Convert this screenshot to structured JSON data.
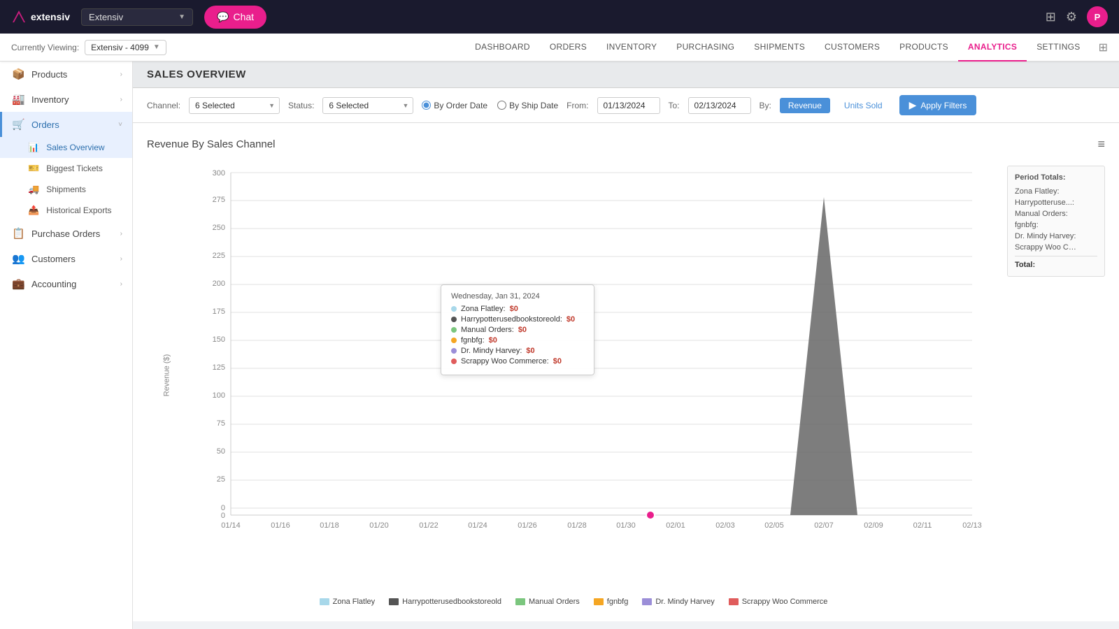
{
  "app": {
    "logo": "extensiv",
    "tenant": "Extensiv",
    "tenant_dropdown_label": "Extensiv",
    "chat_button": "Chat",
    "avatar_initials": "P"
  },
  "subheader": {
    "viewing_label": "Currently Viewing:",
    "viewing_value": "Extensiv - 4099",
    "nav_items": [
      {
        "label": "DASHBOARD",
        "active": false
      },
      {
        "label": "ORDERS",
        "active": false
      },
      {
        "label": "INVENTORY",
        "active": false
      },
      {
        "label": "PURCHASING",
        "active": false
      },
      {
        "label": "SHIPMENTS",
        "active": false
      },
      {
        "label": "CUSTOMERS",
        "active": false
      },
      {
        "label": "PRODUCTS",
        "active": false
      },
      {
        "label": "ANALYTICS",
        "active": true
      },
      {
        "label": "SETTINGS",
        "active": false
      }
    ]
  },
  "sidebar": {
    "items": [
      {
        "label": "Products",
        "icon": "📦",
        "has_children": true,
        "active": false
      },
      {
        "label": "Inventory",
        "icon": "🏭",
        "has_children": true,
        "active": false
      },
      {
        "label": "Orders",
        "icon": "🛒",
        "has_children": true,
        "active": true,
        "expanded": true
      },
      {
        "label": "Purchase Orders",
        "icon": "📋",
        "has_children": true,
        "active": false
      },
      {
        "label": "Customers",
        "icon": "👥",
        "has_children": true,
        "active": false
      },
      {
        "label": "Accounting",
        "icon": "💼",
        "has_children": true,
        "active": false
      }
    ],
    "subitems": [
      {
        "label": "Sales Overview",
        "icon": "📊",
        "active": true
      },
      {
        "label": "Biggest Tickets",
        "icon": "🎫",
        "active": false
      },
      {
        "label": "Shipments",
        "icon": "🚚",
        "active": false
      },
      {
        "label": "Historical Exports",
        "icon": "📤",
        "active": false
      }
    ]
  },
  "page": {
    "title": "SALES OVERVIEW"
  },
  "filters": {
    "channel_label": "Channel:",
    "channel_value": "6 Selected",
    "status_label": "Status:",
    "status_value": "6 Selected",
    "by_order_date": "By Order Date",
    "by_ship_date": "By Ship Date",
    "from_label": "From:",
    "from_value": "01/13/2024",
    "to_label": "To:",
    "to_value": "02/13/2024",
    "by_label": "By:",
    "revenue_btn": "Revenue",
    "units_btn": "Units Sold",
    "apply_btn": "Apply Filters"
  },
  "chart": {
    "title": "Revenue By Sales Channel",
    "y_axis_label": "Revenue ($)",
    "x_labels": [
      "01/14",
      "01/16",
      "01/18",
      "01/20",
      "01/22",
      "01/24",
      "01/26",
      "01/28",
      "01/30",
      "02/01",
      "02/03",
      "02/05",
      "02/07",
      "02/09",
      "02/11",
      "02/13"
    ],
    "y_ticks": [
      "0",
      "25",
      "50",
      "75",
      "100",
      "125",
      "150",
      "175",
      "200",
      "225",
      "250",
      "275",
      "300"
    ],
    "tooltip": {
      "date": "Wednesday, Jan 31, 2024",
      "rows": [
        {
          "label": "Zona Flatley:",
          "value": "$0",
          "color": "#7ec8e3"
        },
        {
          "label": "Harrypotterusedbookstoreold:",
          "value": "$0",
          "color": "#555"
        },
        {
          "label": "Manual Orders:",
          "value": "$0",
          "color": "#7bc67e"
        },
        {
          "label": "fgnbfg:",
          "value": "$0",
          "color": "#f5a623"
        },
        {
          "label": "Dr. Mindy Harvey:",
          "value": "$0",
          "color": "#9b8ed8"
        },
        {
          "label": "Scrappy Woo Commerce:",
          "value": "$0",
          "color": "#e05c5c"
        }
      ]
    },
    "legend": [
      {
        "label": "Zona Flatley",
        "color": "#a8d8ea"
      },
      {
        "label": "Harrypotterusedbookstoreold",
        "color": "#555"
      },
      {
        "label": "Manual Orders",
        "color": "#7bc67e"
      },
      {
        "label": "fgnbfg",
        "color": "#f5a623"
      },
      {
        "label": "Dr. Mindy Harvey",
        "color": "#9b8ed8"
      },
      {
        "label": "Scrappy Woo Commerce",
        "color": "#e05c5c"
      }
    ],
    "period_totals": {
      "title": "Period Totals:",
      "rows": [
        {
          "label": "Zona Flatley:",
          "value": ""
        },
        {
          "label": "Harrypotteruse...:",
          "value": ""
        },
        {
          "label": "Manual Orders:",
          "value": ""
        },
        {
          "label": "fgnbfg:",
          "value": ""
        },
        {
          "label": "Dr. Mindy Harvey:",
          "value": ""
        },
        {
          "label": "Scrappy Woo Co...:",
          "value": ""
        }
      ],
      "total_label": "Total:",
      "total_value": ""
    }
  }
}
